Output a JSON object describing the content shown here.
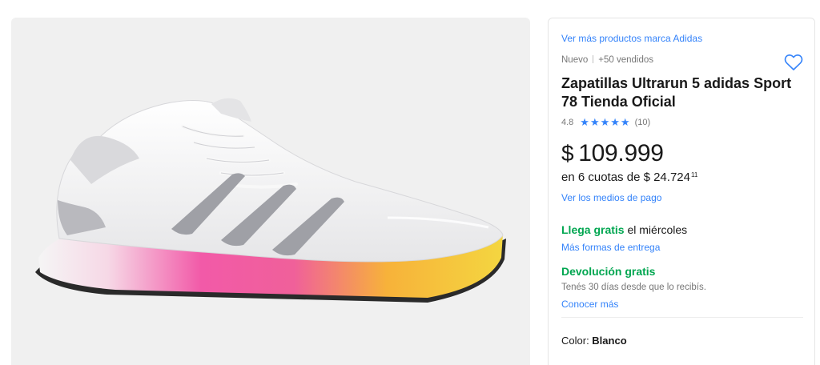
{
  "gallery": {
    "image_alt": "Zapatillas Ultrarun 5 adidas",
    "background_color": "#f0f0f0"
  },
  "product": {
    "brand_link": "Ver más productos marca Adidas",
    "condition": "Nuevo",
    "sold": "+50 vendidos",
    "title": "Zapatillas Ultrarun 5 adidas Sport 78 Tienda Oficial",
    "rating_value": "4.8",
    "rating_count": "(10)",
    "stars": 5,
    "price_currency": "$",
    "price_amount": "109.999",
    "installments_text": "en 6 cuotas de $ 24.724",
    "installments_cents": "11",
    "payment_link": "Ver los medios de pago",
    "shipping_highlight": "Llega gratis",
    "shipping_rest": " el miércoles",
    "shipping_link": "Más formas de entrega",
    "return_title": "Devolución gratis",
    "return_note": "Tenés 30 días desde que lo recibís.",
    "return_link": "Conocer más",
    "color_label": "Color: ",
    "color_value": "Blanco"
  },
  "colors": {
    "accent": "#3483fa",
    "success": "#00a650"
  }
}
